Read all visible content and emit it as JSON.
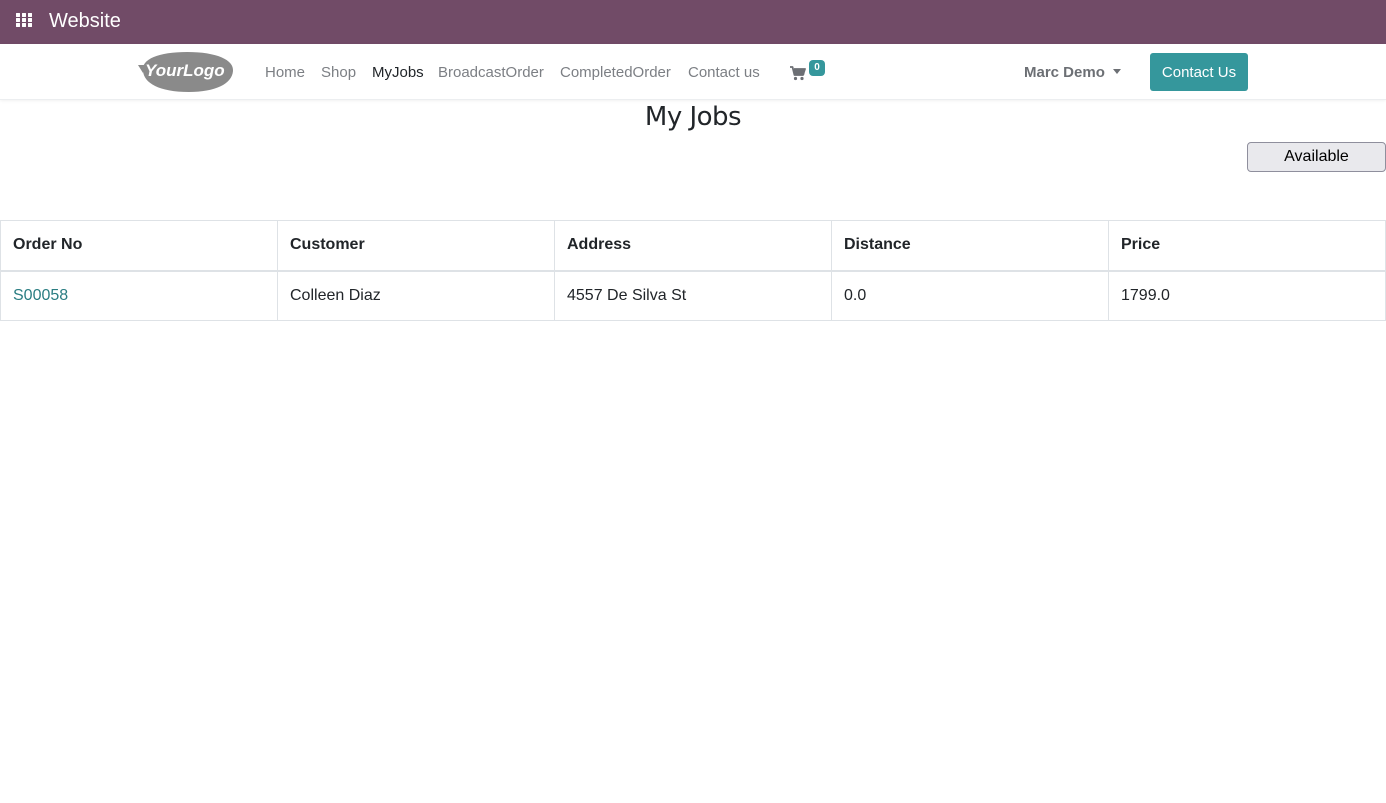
{
  "topbar": {
    "app_title": "Website",
    "apps_icon": "grid-icon",
    "background": "#714b67"
  },
  "navbar": {
    "logo_text": "YourLogo",
    "links": [
      {
        "label": "Home",
        "active": false
      },
      {
        "label": "Shop",
        "active": false
      },
      {
        "label": "MyJobs",
        "active": true
      },
      {
        "label": "BroadcastOrder",
        "active": false
      },
      {
        "label": "CompletedOrder",
        "active": false
      },
      {
        "label": "Contact us",
        "active": false
      }
    ],
    "cart": {
      "icon": "shopping-cart-icon",
      "count": "0"
    },
    "user_name": "Marc Demo",
    "cta_label": "Contact Us",
    "accent": "#35979c"
  },
  "main": {
    "title": "My Jobs",
    "status_button": "Available",
    "table": {
      "columns": [
        "Order No",
        "Customer",
        "Address",
        "Distance",
        "Price"
      ],
      "rows": [
        {
          "order_no": "S00058",
          "customer": "Colleen Diaz",
          "address": "4557 De Silva St",
          "distance": "0.0",
          "price": "1799.0"
        }
      ]
    }
  }
}
